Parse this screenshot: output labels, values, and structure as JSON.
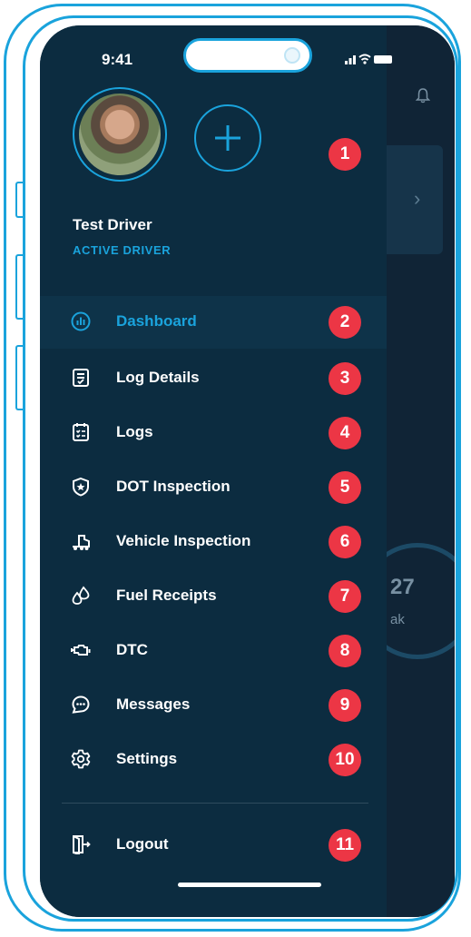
{
  "status_bar": {
    "time": "9:41"
  },
  "profile": {
    "name": "Test Driver",
    "status": "ACTIVE DRIVER"
  },
  "menu": {
    "items": [
      {
        "label": "Dashboard",
        "icon": "dashboard-chart-icon",
        "badge": "2",
        "active": true
      },
      {
        "label": "Log Details",
        "icon": "log-details-icon",
        "badge": "3"
      },
      {
        "label": "Logs",
        "icon": "logs-checklist-icon",
        "badge": "4"
      },
      {
        "label": "DOT Inspection",
        "icon": "shield-star-icon",
        "badge": "5"
      },
      {
        "label": "Vehicle Inspection",
        "icon": "truck-icon",
        "badge": "6"
      },
      {
        "label": "Fuel Receipts",
        "icon": "fuel-drops-icon",
        "badge": "7"
      },
      {
        "label": "DTC",
        "icon": "engine-icon",
        "badge": "8"
      },
      {
        "label": "Messages",
        "icon": "chat-bubble-icon",
        "badge": "9"
      },
      {
        "label": "Settings",
        "icon": "gear-icon",
        "badge": "10"
      }
    ],
    "logout": {
      "label": "Logout",
      "icon": "logout-door-icon",
      "badge": "11"
    }
  },
  "annotations": {
    "profile_badge": "1"
  },
  "background_screen": {
    "gauge_value": "27",
    "gauge_unit": "ak"
  },
  "colors": {
    "accent": "#1aa3dc",
    "badge": "#ec3645",
    "drawer_bg": "#0c2c40"
  }
}
